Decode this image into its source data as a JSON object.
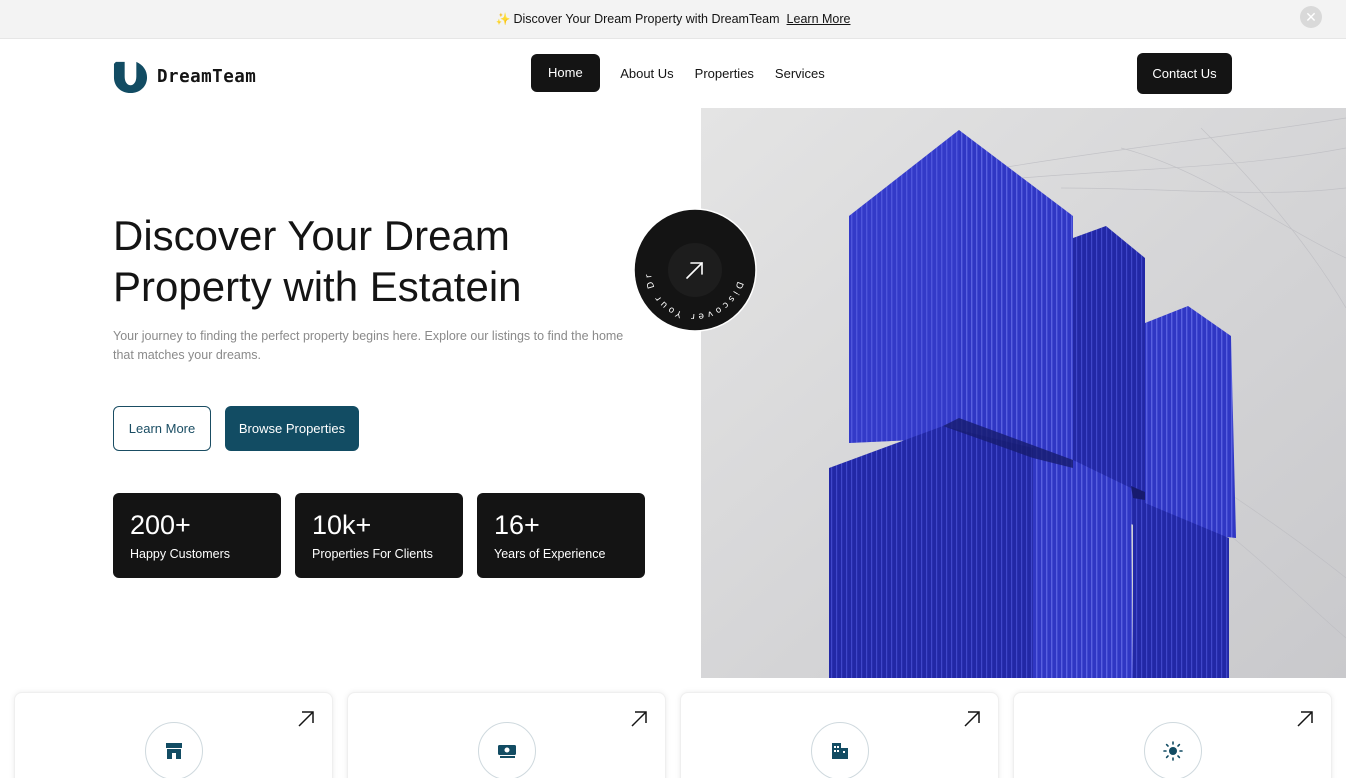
{
  "announcement": {
    "sparkle_icon": "sparkle-icon",
    "text": "Discover Your Dream Property with DreamTeam",
    "link_label": "Learn More",
    "close_icon": "close-icon"
  },
  "header": {
    "logo_text": "DreamTeam",
    "nav": [
      {
        "label": "Home",
        "active": true
      },
      {
        "label": "About Us",
        "active": false
      },
      {
        "label": "Properties",
        "active": false
      },
      {
        "label": "Services",
        "active": false
      }
    ],
    "contact_label": "Contact Us"
  },
  "hero": {
    "title": "Discover Your Dream\nProperty with Estatein",
    "subtitle": "Your journey to finding the perfect property begins here. Explore our listings to find the home that matches your dreams.",
    "learn_more_label": "Learn More",
    "browse_label": "Browse Properties",
    "badge_text": "Discover Your Dream Property",
    "stats": [
      {
        "value": "200+",
        "label": "Happy Customers"
      },
      {
        "value": "10k+",
        "label": "Properties For Clients"
      },
      {
        "value": "16+",
        "label": "Years of Experience"
      }
    ]
  },
  "colors": {
    "accent": "#124c63",
    "dark": "#141414",
    "building": "#2d34c9"
  },
  "feature_cards": [
    {
      "icon": "storefront-icon",
      "arrow_icon": "arrow-up-right-icon"
    },
    {
      "icon": "money-icon",
      "arrow_icon": "arrow-up-right-icon"
    },
    {
      "icon": "buildings-icon",
      "arrow_icon": "arrow-up-right-icon"
    },
    {
      "icon": "sun-icon",
      "arrow_icon": "arrow-up-right-icon"
    }
  ]
}
